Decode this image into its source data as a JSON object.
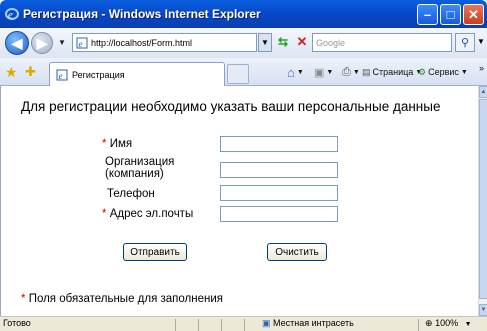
{
  "window": {
    "title": "Регистрация - Windows Internet Explorer"
  },
  "addressbar": {
    "url": "http://localhost/Form.html",
    "search_placeholder": "Google"
  },
  "tabs": {
    "active_label": "Регистрация"
  },
  "toolbar": {
    "page_label": "Страница",
    "service_label": "Сервис",
    "overflow": "»"
  },
  "form": {
    "heading": "Для регистрации необходимо указать ваши персональные данные",
    "required_mark": "*",
    "fields": [
      {
        "label": "Имя",
        "required": true,
        "value": ""
      },
      {
        "label": "Организация\n(компания)",
        "required": false,
        "value": ""
      },
      {
        "label": "Телефон",
        "required": false,
        "value": ""
      },
      {
        "label": "Адрес эл.почты",
        "required": true,
        "value": ""
      }
    ],
    "submit_label": "Отправить",
    "reset_label": "Очистить",
    "note": "Поля обязательные для заполнения"
  },
  "statusbar": {
    "status": "Готово",
    "zone": "Местная интрасеть",
    "zoom": "100%"
  },
  "colors": {
    "titlebar": "#0848c8",
    "required": "#d00000"
  }
}
